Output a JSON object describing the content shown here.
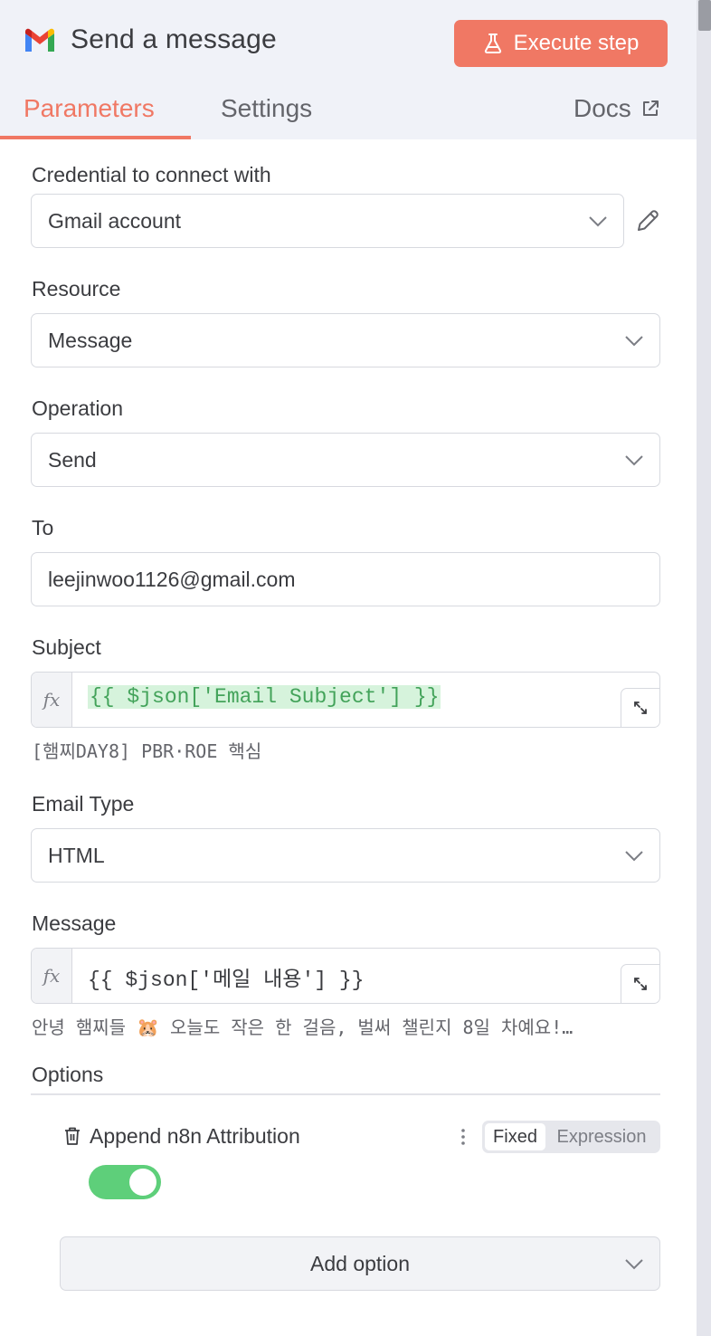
{
  "header": {
    "title": "Send a message",
    "execute_label": "Execute step",
    "logo_icon": "gmail-icon"
  },
  "tabs": [
    {
      "label": "Parameters",
      "active": true
    },
    {
      "label": "Settings",
      "active": false
    },
    {
      "label": "Docs",
      "active": false
    }
  ],
  "credential": {
    "label": "Credential to connect with",
    "value": "Gmail account"
  },
  "resource": {
    "label": "Resource",
    "value": "Message"
  },
  "operation": {
    "label": "Operation",
    "value": "Send"
  },
  "to": {
    "label": "To",
    "value": "leejinwoo1126@gmail.com"
  },
  "subject": {
    "label": "Subject",
    "expression": "{{ $json['Email Subject'] }}",
    "preview": "[햄찌DAY8] PBR·ROE 핵심"
  },
  "email_type": {
    "label": "Email Type",
    "value": "HTML"
  },
  "message": {
    "label": "Message",
    "expression": "{{ $json['메일 내용'] }}",
    "preview": "안녕 햄찌들 🐹 오늘도 작은 한 걸음, 벌써 챌린지 8일 차예요!…"
  },
  "options": {
    "label": "Options",
    "attribution": {
      "label": "Append n8n Attribution",
      "mode_fixed": "Fixed",
      "mode_expression": "Expression",
      "enabled": true
    },
    "add_label": "Add option"
  },
  "colors": {
    "accent": "#f07864",
    "toggle_on": "#5ecf7a",
    "expression_text": "#43a35a"
  }
}
